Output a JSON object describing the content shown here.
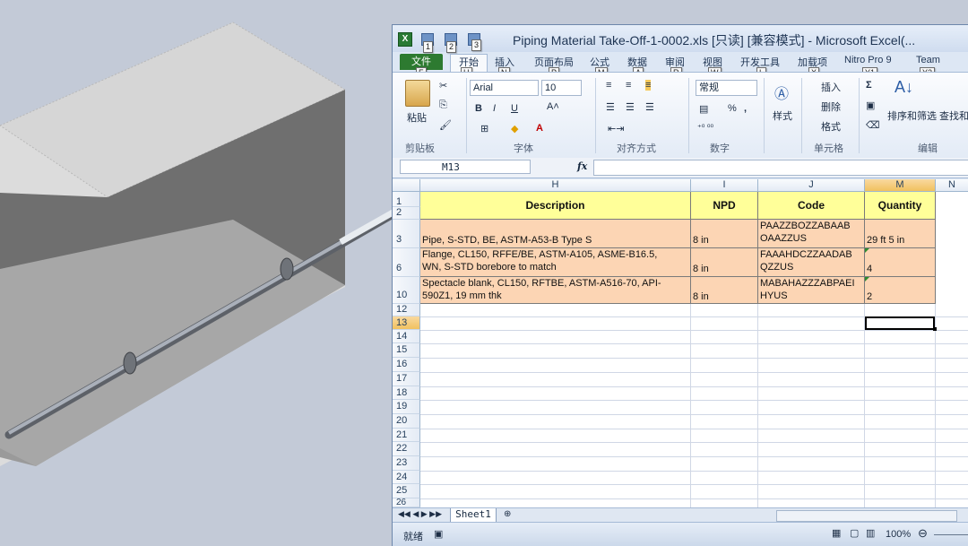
{
  "window": {
    "title": "Piping Material Take-Off-1-0002.xls  [只读]  [兼容模式] - Microsoft Excel(...",
    "logo": "X"
  },
  "keytips": [
    "1",
    "2",
    "3",
    "F",
    "H",
    "N",
    "P",
    "M",
    "A",
    "R",
    "W",
    "L",
    "X",
    "Y1",
    "Y2"
  ],
  "tabs": [
    "文件",
    "开始",
    "插入",
    "页面布局",
    "公式",
    "数据",
    "审阅",
    "视图",
    "开发工具",
    "加载项",
    "Nitro Pro 9",
    "Team"
  ],
  "ribbon": {
    "groups": [
      "剪贴板",
      "字体",
      "对齐方式",
      "数字",
      "样式",
      "单元格",
      "编辑"
    ],
    "paste_label": "粘贴",
    "font_name": "Arial",
    "font_size": "10",
    "number_format": "常规",
    "style_label": "样式",
    "insert_label": "插入",
    "delete_label": "删除",
    "format_label": "格式",
    "sort_filter_label": "排序和筛选",
    "find_label": "查找和",
    "bold": "B",
    "italic": "I",
    "underline": "U",
    "percent": "%",
    "comma": ","
  },
  "formula_bar": {
    "name_box": "M13",
    "fx": "fx",
    "value": ""
  },
  "grid": {
    "columns": [
      "H",
      "I",
      "J",
      "M",
      "N"
    ],
    "rows": [
      "1",
      "2",
      "3",
      "6",
      "10",
      "12",
      "13",
      "14",
      "15",
      "16",
      "17",
      "18",
      "19",
      "20",
      "21",
      "22",
      "23",
      "24",
      "25",
      "26"
    ],
    "header_row": {
      "H": "Description",
      "I": "NPD",
      "J": "Code",
      "M": "Quantity"
    },
    "data_rows": [
      {
        "row": "3",
        "H": "Pipe, S-STD, BE, ASTM-A53-B Type S",
        "I": "8 in",
        "J_line1": "PAAZZBOZZABAAB",
        "J_line2": "OAAZZUS",
        "M": "29 ft  5 in"
      },
      {
        "row": "6",
        "H_line1": "Flange, CL150, RFFE/BE, ASTM-A105, ASME-B16.5,",
        "H_line2": "WN, S-STD borebore to match",
        "I": "8 in",
        "J_line1": "FAAAHDCZZAADAB",
        "J_line2": "QZZUS",
        "M": "4"
      },
      {
        "row": "10",
        "H_line1": "Spectacle blank, CL150, RFTBE, ASTM-A516-70, API-",
        "H_line2": "590Z1, 19 mm thk",
        "I": "8 in",
        "J_line1": "MABAHAZZZABPAEI",
        "J_line2": "HYUS",
        "M": "2"
      }
    ]
  },
  "sheet_tab": "Sheet1",
  "status": {
    "ready": "就绪",
    "zoom": "100%"
  },
  "colors": {
    "header_fill": "#ffff99",
    "data_fill": "#fcd5b4",
    "file_tab": "#2d7a30"
  }
}
